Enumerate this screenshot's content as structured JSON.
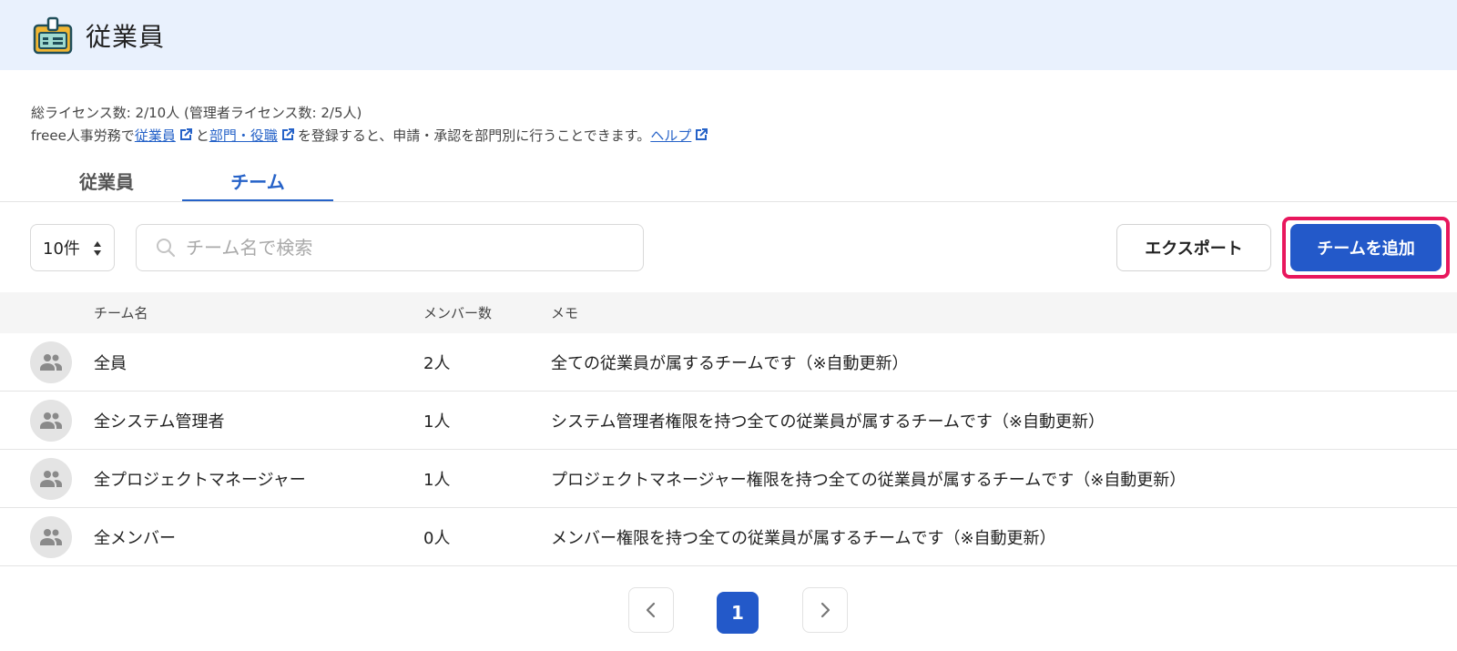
{
  "header": {
    "title": "従業員",
    "icon": "id-badge-icon"
  },
  "info": {
    "license_line": "総ライセンス数: 2/10人 (管理者ライセンス数: 2/5人)",
    "desc_prefix": "freee人事労務で",
    "link_employee": "従業員",
    "desc_and": "と",
    "link_department": "部門・役職",
    "desc_suffix": "を登録すると、申請・承認を部門別に行うことできます。",
    "link_help": "ヘルプ"
  },
  "tabs": [
    {
      "label": "従業員",
      "active": false
    },
    {
      "label": "チーム",
      "active": true
    }
  ],
  "toolbar": {
    "per_page": "10件",
    "search_placeholder": "チーム名で検索",
    "export_label": "エクスポート",
    "add_label": "チームを追加"
  },
  "table": {
    "headers": {
      "name": "チーム名",
      "count": "メンバー数",
      "memo": "メモ"
    },
    "rows": [
      {
        "name": "全員",
        "count": "2人",
        "memo": "全ての従業員が属するチームです（※自動更新）"
      },
      {
        "name": "全システム管理者",
        "count": "1人",
        "memo": "システム管理者権限を持つ全ての従業員が属するチームです（※自動更新）"
      },
      {
        "name": "全プロジェクトマネージャー",
        "count": "1人",
        "memo": "プロジェクトマネージャー権限を持つ全ての従業員が属するチームです（※自動更新）"
      },
      {
        "name": "全メンバー",
        "count": "0人",
        "memo": "メンバー権限を持つ全ての従業員が属するチームです（※自動更新）"
      }
    ]
  },
  "pagination": {
    "current": "1"
  },
  "colors": {
    "accent": "#2359c9",
    "highlight": "#e8175d",
    "header_bg": "#e9f1fd"
  }
}
